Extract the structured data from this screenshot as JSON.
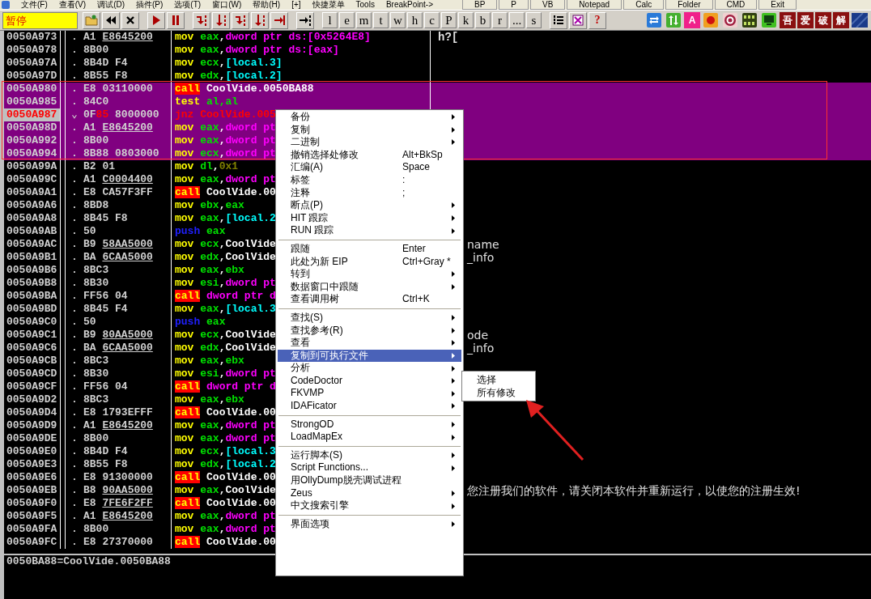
{
  "menubar": {
    "items": [
      "文件(F)",
      "查看(V)",
      "调试(D)",
      "插件(P)",
      "选项(T)",
      "窗口(W)",
      "帮助(H)",
      "[+]",
      "快捷菜单",
      "Tools",
      "BreakPoint->"
    ],
    "buttons": [
      "BP",
      "P",
      "VB",
      "Notepad",
      "Calc",
      "Folder",
      "CMD",
      "Exit"
    ]
  },
  "toolbar": {
    "status": "暂停",
    "letters": [
      "l",
      "e",
      "m",
      "t",
      "w",
      "h",
      "c",
      "P",
      "k",
      "b",
      "r",
      "...",
      "s"
    ],
    "help": "?",
    "plugin_texts": [
      "A",
      "吾",
      "爱",
      "破",
      "解"
    ]
  },
  "disassembly": {
    "rows": [
      {
        "address": "0050A973",
        "marker": ".",
        "selected": false,
        "current": false,
        "hex": [
          {
            "text": "A1",
            "kind": "plain"
          },
          {
            "text": "E8645200",
            "kind": "reloc"
          }
        ],
        "code": [
          {
            "text": "mov",
            "kind": "op"
          },
          {
            "text": "eax",
            "kind": "reg"
          },
          {
            "text": ",",
            "kind": "punct"
          },
          {
            "text": "dword ptr ds:[0x5264E8]",
            "kind": "mem"
          }
        ],
        "comment": "h?["
      },
      {
        "address": "0050A978",
        "marker": ".",
        "selected": false,
        "current": false,
        "hex": [
          {
            "text": "8B00",
            "kind": "plain"
          }
        ],
        "code": [
          {
            "text": "mov",
            "kind": "op"
          },
          {
            "text": "eax",
            "kind": "reg"
          },
          {
            "text": ",",
            "kind": "punct"
          },
          {
            "text": "dword ptr ds:[eax]",
            "kind": "mem"
          }
        ]
      },
      {
        "address": "0050A97A",
        "marker": ".",
        "selected": false,
        "current": false,
        "hex": [
          {
            "text": "8B4D",
            "kind": "plain"
          },
          {
            "text": "F4",
            "kind": "plain"
          }
        ],
        "code": [
          {
            "text": "mov",
            "kind": "op"
          },
          {
            "text": "ecx",
            "kind": "reg"
          },
          {
            "text": ",",
            "kind": "punct"
          },
          {
            "text": "[local.3]",
            "kind": "local"
          }
        ]
      },
      {
        "address": "0050A97D",
        "marker": ".",
        "selected": false,
        "current": false,
        "hex": [
          {
            "text": "8B55",
            "kind": "plain"
          },
          {
            "text": "F8",
            "kind": "plain"
          }
        ],
        "code": [
          {
            "text": "mov",
            "kind": "op"
          },
          {
            "text": "edx",
            "kind": "reg"
          },
          {
            "text": ",",
            "kind": "punct"
          },
          {
            "text": "[local.2]",
            "kind": "local"
          }
        ]
      },
      {
        "address": "0050A980",
        "marker": ".",
        "selected": true,
        "current": false,
        "hex": [
          {
            "text": "E8",
            "kind": "plain"
          },
          {
            "text": "03110000",
            "kind": "plain"
          }
        ],
        "code": [
          {
            "text": "call",
            "kind": "call"
          },
          {
            "text": "CoolVide.0050BA88",
            "kind": "sym"
          }
        ]
      },
      {
        "address": "0050A985",
        "marker": ".",
        "selected": true,
        "current": false,
        "hex": [
          {
            "text": "84C0",
            "kind": "plain"
          }
        ],
        "code": [
          {
            "text": "test",
            "kind": "op"
          },
          {
            "text": "al,al",
            "kind": "reg"
          }
        ]
      },
      {
        "address": "0050A987",
        "marker": "⌄",
        "selected": true,
        "current": true,
        "hex": [
          {
            "text": "0F",
            "kind": "plain"
          },
          {
            "text": "85",
            "kind": "changed"
          },
          {
            "text": "8000000",
            "kind": "plain"
          }
        ],
        "code": [
          {
            "text": "jnz",
            "kind": "jump"
          },
          {
            "text": "CoolVide.005",
            "kind": "jump"
          }
        ]
      },
      {
        "address": "0050A98D",
        "marker": ".",
        "selected": true,
        "current": false,
        "hex": [
          {
            "text": "A1",
            "kind": "plain"
          },
          {
            "text": "E8645200",
            "kind": "reloc"
          }
        ],
        "code": [
          {
            "text": "mov",
            "kind": "op"
          },
          {
            "text": "eax",
            "kind": "reg"
          },
          {
            "text": ",",
            "kind": "punct"
          },
          {
            "text": "dword pt",
            "kind": "mem"
          }
        ]
      },
      {
        "address": "0050A992",
        "marker": ".",
        "selected": true,
        "current": false,
        "hex": [
          {
            "text": "8B00",
            "kind": "plain"
          }
        ],
        "code": [
          {
            "text": "mov",
            "kind": "op"
          },
          {
            "text": "eax",
            "kind": "reg"
          },
          {
            "text": ",",
            "kind": "punct"
          },
          {
            "text": "dword pt",
            "kind": "mem"
          }
        ]
      },
      {
        "address": "0050A994",
        "marker": ".",
        "selected": true,
        "current": false,
        "hex": [
          {
            "text": "8B88",
            "kind": "plain"
          },
          {
            "text": "0803000",
            "kind": "plain"
          }
        ],
        "code": [
          {
            "text": "mov",
            "kind": "op"
          },
          {
            "text": "ecx",
            "kind": "reg"
          },
          {
            "text": ",",
            "kind": "punct"
          },
          {
            "text": "dword pt",
            "kind": "mem"
          }
        ]
      },
      {
        "address": "0050A99A",
        "marker": ".",
        "selected": false,
        "current": false,
        "hex": [
          {
            "text": "B2",
            "kind": "plain"
          },
          {
            "text": "01",
            "kind": "plain"
          }
        ],
        "code": [
          {
            "text": "mov",
            "kind": "op"
          },
          {
            "text": "dl",
            "kind": "reg"
          },
          {
            "text": ",",
            "kind": "punct"
          },
          {
            "text": "0x1",
            "kind": "imm"
          }
        ]
      },
      {
        "address": "0050A99C",
        "marker": ".",
        "selected": false,
        "current": false,
        "hex": [
          {
            "text": "A1",
            "kind": "plain"
          },
          {
            "text": "C0004400",
            "kind": "reloc"
          }
        ],
        "code": [
          {
            "text": "mov",
            "kind": "op"
          },
          {
            "text": "eax",
            "kind": "reg"
          },
          {
            "text": ",",
            "kind": "punct"
          },
          {
            "text": "dword pt",
            "kind": "mem"
          }
        ]
      },
      {
        "address": "0050A9A1",
        "marker": ".",
        "selected": false,
        "current": false,
        "hex": [
          {
            "text": "E8",
            "kind": "plain"
          },
          {
            "text": "CA57F3FF",
            "kind": "plain"
          }
        ],
        "code": [
          {
            "text": "call",
            "kind": "call"
          },
          {
            "text": "CoolVide.00",
            "kind": "sym"
          }
        ]
      },
      {
        "address": "0050A9A6",
        "marker": ".",
        "selected": false,
        "current": false,
        "hex": [
          {
            "text": "8BD8",
            "kind": "plain"
          }
        ],
        "code": [
          {
            "text": "mov",
            "kind": "op"
          },
          {
            "text": "ebx",
            "kind": "reg"
          },
          {
            "text": ",",
            "kind": "punct"
          },
          {
            "text": "eax",
            "kind": "reg"
          }
        ]
      },
      {
        "address": "0050A9A8",
        "marker": ".",
        "selected": false,
        "current": false,
        "hex": [
          {
            "text": "8B45",
            "kind": "plain"
          },
          {
            "text": "F8",
            "kind": "plain"
          }
        ],
        "code": [
          {
            "text": "mov",
            "kind": "op"
          },
          {
            "text": "eax",
            "kind": "reg"
          },
          {
            "text": ",",
            "kind": "punct"
          },
          {
            "text": "[local.2",
            "kind": "local"
          }
        ]
      },
      {
        "address": "0050A9AB",
        "marker": ".",
        "selected": false,
        "current": false,
        "hex": [
          {
            "text": "50",
            "kind": "plain"
          }
        ],
        "code": [
          {
            "text": "push",
            "kind": "push"
          },
          {
            "text": "eax",
            "kind": "reg"
          }
        ]
      },
      {
        "address": "0050A9AC",
        "marker": ".",
        "selected": false,
        "current": false,
        "hex": [
          {
            "text": "B9",
            "kind": "plain"
          },
          {
            "text": "58AA5000",
            "kind": "reloc"
          }
        ],
        "code": [
          {
            "text": "mov",
            "kind": "op"
          },
          {
            "text": "ecx",
            "kind": "reg"
          },
          {
            "text": ",",
            "kind": "punct"
          },
          {
            "text": "CoolVide",
            "kind": "sym"
          }
        ],
        "comment": "name",
        "comment_clipped": true
      },
      {
        "address": "0050A9B1",
        "marker": ".",
        "selected": false,
        "current": false,
        "hex": [
          {
            "text": "BA",
            "kind": "plain"
          },
          {
            "text": "6CAA5000",
            "kind": "reloc"
          }
        ],
        "code": [
          {
            "text": "mov",
            "kind": "op"
          },
          {
            "text": "edx",
            "kind": "reg"
          },
          {
            "text": ",",
            "kind": "punct"
          },
          {
            "text": "CoolVide",
            "kind": "sym"
          }
        ],
        "comment": "_info",
        "comment_clipped": true
      },
      {
        "address": "0050A9B6",
        "marker": ".",
        "selected": false,
        "current": false,
        "hex": [
          {
            "text": "8BC3",
            "kind": "plain"
          }
        ],
        "code": [
          {
            "text": "mov",
            "kind": "op"
          },
          {
            "text": "eax",
            "kind": "reg"
          },
          {
            "text": ",",
            "kind": "punct"
          },
          {
            "text": "ebx",
            "kind": "reg"
          }
        ]
      },
      {
        "address": "0050A9B8",
        "marker": ".",
        "selected": false,
        "current": false,
        "hex": [
          {
            "text": "8B30",
            "kind": "plain"
          }
        ],
        "code": [
          {
            "text": "mov",
            "kind": "op"
          },
          {
            "text": "esi",
            "kind": "reg"
          },
          {
            "text": ",",
            "kind": "punct"
          },
          {
            "text": "dword pt",
            "kind": "mem"
          }
        ]
      },
      {
        "address": "0050A9BA",
        "marker": ".",
        "selected": false,
        "current": false,
        "hex": [
          {
            "text": "FF56",
            "kind": "plain"
          },
          {
            "text": "04",
            "kind": "plain"
          }
        ],
        "code": [
          {
            "text": "call",
            "kind": "call"
          },
          {
            "text": "dword ptr d",
            "kind": "mem"
          }
        ]
      },
      {
        "address": "0050A9BD",
        "marker": ".",
        "selected": false,
        "current": false,
        "hex": [
          {
            "text": "8B45",
            "kind": "plain"
          },
          {
            "text": "F4",
            "kind": "plain"
          }
        ],
        "code": [
          {
            "text": "mov",
            "kind": "op"
          },
          {
            "text": "eax",
            "kind": "reg"
          },
          {
            "text": ",",
            "kind": "punct"
          },
          {
            "text": "[local.3",
            "kind": "local"
          }
        ]
      },
      {
        "address": "0050A9C0",
        "marker": ".",
        "selected": false,
        "current": false,
        "hex": [
          {
            "text": "50",
            "kind": "plain"
          }
        ],
        "code": [
          {
            "text": "push",
            "kind": "push"
          },
          {
            "text": "eax",
            "kind": "reg"
          }
        ]
      },
      {
        "address": "0050A9C1",
        "marker": ".",
        "selected": false,
        "current": false,
        "hex": [
          {
            "text": "B9",
            "kind": "plain"
          },
          {
            "text": "80AA5000",
            "kind": "reloc"
          }
        ],
        "code": [
          {
            "text": "mov",
            "kind": "op"
          },
          {
            "text": "ecx",
            "kind": "reg"
          },
          {
            "text": ",",
            "kind": "punct"
          },
          {
            "text": "CoolVide",
            "kind": "sym"
          }
        ],
        "comment": "ode",
        "comment_clipped": true
      },
      {
        "address": "0050A9C6",
        "marker": ".",
        "selected": false,
        "current": false,
        "hex": [
          {
            "text": "BA",
            "kind": "plain"
          },
          {
            "text": "6CAA5000",
            "kind": "reloc"
          }
        ],
        "code": [
          {
            "text": "mov",
            "kind": "op"
          },
          {
            "text": "edx",
            "kind": "reg"
          },
          {
            "text": ",",
            "kind": "punct"
          },
          {
            "text": "CoolVide",
            "kind": "sym"
          }
        ],
        "comment": "_info",
        "comment_clipped": true
      },
      {
        "address": "0050A9CB",
        "marker": ".",
        "selected": false,
        "current": false,
        "hex": [
          {
            "text": "8BC3",
            "kind": "plain"
          }
        ],
        "code": [
          {
            "text": "mov",
            "kind": "op"
          },
          {
            "text": "eax",
            "kind": "reg"
          },
          {
            "text": ",",
            "kind": "punct"
          },
          {
            "text": "ebx",
            "kind": "reg"
          }
        ]
      },
      {
        "address": "0050A9CD",
        "marker": ".",
        "selected": false,
        "current": false,
        "hex": [
          {
            "text": "8B30",
            "kind": "plain"
          }
        ],
        "code": [
          {
            "text": "mov",
            "kind": "op"
          },
          {
            "text": "esi",
            "kind": "reg"
          },
          {
            "text": ",",
            "kind": "punct"
          },
          {
            "text": "dword pt",
            "kind": "mem"
          }
        ]
      },
      {
        "address": "0050A9CF",
        "marker": ".",
        "selected": false,
        "current": false,
        "hex": [
          {
            "text": "FF56",
            "kind": "plain"
          },
          {
            "text": "04",
            "kind": "plain"
          }
        ],
        "code": [
          {
            "text": "call",
            "kind": "call"
          },
          {
            "text": "dword ptr d",
            "kind": "mem"
          }
        ]
      },
      {
        "address": "0050A9D2",
        "marker": ".",
        "selected": false,
        "current": false,
        "hex": [
          {
            "text": "8BC3",
            "kind": "plain"
          }
        ],
        "code": [
          {
            "text": "mov",
            "kind": "op"
          },
          {
            "text": "eax",
            "kind": "reg"
          },
          {
            "text": ",",
            "kind": "punct"
          },
          {
            "text": "ebx",
            "kind": "reg"
          }
        ]
      },
      {
        "address": "0050A9D4",
        "marker": ".",
        "selected": false,
        "current": false,
        "hex": [
          {
            "text": "E8",
            "kind": "plain"
          },
          {
            "text": "1793EFFF",
            "kind": "plain"
          }
        ],
        "code": [
          {
            "text": "call",
            "kind": "call"
          },
          {
            "text": "CoolVide.00",
            "kind": "sym"
          }
        ]
      },
      {
        "address": "0050A9D9",
        "marker": ".",
        "selected": false,
        "current": false,
        "hex": [
          {
            "text": "A1",
            "kind": "plain"
          },
          {
            "text": "E8645200",
            "kind": "reloc"
          }
        ],
        "code": [
          {
            "text": "mov",
            "kind": "op"
          },
          {
            "text": "eax",
            "kind": "reg"
          },
          {
            "text": ",",
            "kind": "punct"
          },
          {
            "text": "dword pt",
            "kind": "mem"
          }
        ]
      },
      {
        "address": "0050A9DE",
        "marker": ".",
        "selected": false,
        "current": false,
        "hex": [
          {
            "text": "8B00",
            "kind": "plain"
          }
        ],
        "code": [
          {
            "text": "mov",
            "kind": "op"
          },
          {
            "text": "eax",
            "kind": "reg"
          },
          {
            "text": ",",
            "kind": "punct"
          },
          {
            "text": "dword pt",
            "kind": "mem"
          }
        ]
      },
      {
        "address": "0050A9E0",
        "marker": ".",
        "selected": false,
        "current": false,
        "hex": [
          {
            "text": "8B4D",
            "kind": "plain"
          },
          {
            "text": "F4",
            "kind": "plain"
          }
        ],
        "code": [
          {
            "text": "mov",
            "kind": "op"
          },
          {
            "text": "ecx",
            "kind": "reg"
          },
          {
            "text": ",",
            "kind": "punct"
          },
          {
            "text": "[local.3",
            "kind": "local"
          }
        ]
      },
      {
        "address": "0050A9E3",
        "marker": ".",
        "selected": false,
        "current": false,
        "hex": [
          {
            "text": "8B55",
            "kind": "plain"
          },
          {
            "text": "F8",
            "kind": "plain"
          }
        ],
        "code": [
          {
            "text": "mov",
            "kind": "op"
          },
          {
            "text": "edx",
            "kind": "reg"
          },
          {
            "text": ",",
            "kind": "punct"
          },
          {
            "text": "[local.2",
            "kind": "local"
          }
        ]
      },
      {
        "address": "0050A9E6",
        "marker": ".",
        "selected": false,
        "current": false,
        "hex": [
          {
            "text": "E8",
            "kind": "plain"
          },
          {
            "text": "91300000",
            "kind": "plain"
          }
        ],
        "code": [
          {
            "text": "call",
            "kind": "call"
          },
          {
            "text": "CoolVide.00",
            "kind": "sym"
          }
        ]
      },
      {
        "address": "0050A9EB",
        "marker": ".",
        "selected": false,
        "current": false,
        "hex": [
          {
            "text": "B8",
            "kind": "plain"
          },
          {
            "text": "90AA5000",
            "kind": "reloc"
          }
        ],
        "code": [
          {
            "text": "mov",
            "kind": "op"
          },
          {
            "text": "eax",
            "kind": "reg"
          },
          {
            "text": ",",
            "kind": "punct"
          },
          {
            "text": "CoolVide",
            "kind": "sym"
          }
        ],
        "comment": "您注册我们的软件，请关闭本软件并重新运行，以使您的注册生效!",
        "comment_clipped": true
      },
      {
        "address": "0050A9F0",
        "marker": ".",
        "selected": false,
        "current": false,
        "hex": [
          {
            "text": "E8",
            "kind": "plain"
          },
          {
            "text": "7FE6F2FF",
            "kind": "reloc"
          }
        ],
        "code": [
          {
            "text": "call",
            "kind": "call"
          },
          {
            "text": "CoolVide.00",
            "kind": "sym"
          }
        ]
      },
      {
        "address": "0050A9F5",
        "marker": ".",
        "selected": false,
        "current": false,
        "hex": [
          {
            "text": "A1",
            "kind": "plain"
          },
          {
            "text": "E8645200",
            "kind": "reloc"
          }
        ],
        "code": [
          {
            "text": "mov",
            "kind": "op"
          },
          {
            "text": "eax",
            "kind": "reg"
          },
          {
            "text": ",",
            "kind": "punct"
          },
          {
            "text": "dword pt",
            "kind": "mem"
          }
        ]
      },
      {
        "address": "0050A9FA",
        "marker": ".",
        "selected": false,
        "current": false,
        "hex": [
          {
            "text": "8B00",
            "kind": "plain"
          }
        ],
        "code": [
          {
            "text": "mov",
            "kind": "op"
          },
          {
            "text": "eax",
            "kind": "reg"
          },
          {
            "text": ",",
            "kind": "punct"
          },
          {
            "text": "dword pt",
            "kind": "mem"
          }
        ]
      },
      {
        "address": "0050A9FC",
        "marker": ".",
        "selected": false,
        "current": false,
        "hex": [
          {
            "text": "E8",
            "kind": "plain"
          },
          {
            "text": "27370000",
            "kind": "plain"
          }
        ],
        "code": [
          {
            "text": "call",
            "kind": "call"
          },
          {
            "text": "CoolVide.00",
            "kind": "sym"
          }
        ]
      }
    ]
  },
  "context_menu": {
    "items": [
      {
        "kind": "item",
        "label": "备份",
        "submenu": true,
        "selected": false
      },
      {
        "kind": "item",
        "label": "复制",
        "submenu": true,
        "selected": false
      },
      {
        "kind": "item",
        "label": "二进制",
        "submenu": true,
        "selected": false
      },
      {
        "kind": "item",
        "label": "撤销选择处修改",
        "shortcut": "Alt+BkSp",
        "submenu": false,
        "selected": false
      },
      {
        "kind": "item",
        "label": "汇编(A)",
        "shortcut": "Space",
        "submenu": false,
        "selected": false
      },
      {
        "kind": "item",
        "label": "标签",
        "shortcut": ":",
        "submenu": false,
        "selected": false
      },
      {
        "kind": "item",
        "label": "注释",
        "shortcut": ";",
        "submenu": false,
        "selected": false
      },
      {
        "kind": "item",
        "label": "断点(P)",
        "submenu": true,
        "selected": false
      },
      {
        "kind": "item",
        "label": "HIT 跟踪",
        "submenu": true,
        "selected": false
      },
      {
        "kind": "item",
        "label": "RUN 跟踪",
        "submenu": true,
        "selected": false
      },
      {
        "kind": "separator"
      },
      {
        "kind": "item",
        "label": "跟随",
        "shortcut": "Enter",
        "submenu": false,
        "selected": false
      },
      {
        "kind": "item",
        "label": "此处为新 EIP",
        "shortcut": "Ctrl+Gray *",
        "submenu": false,
        "selected": false
      },
      {
        "kind": "item",
        "label": "转到",
        "submenu": true,
        "selected": false
      },
      {
        "kind": "item",
        "label": "数据窗口中跟随",
        "submenu": true,
        "selected": false
      },
      {
        "kind": "item",
        "label": "查看调用树",
        "shortcut": "Ctrl+K",
        "submenu": false,
        "selected": false
      },
      {
        "kind": "separator"
      },
      {
        "kind": "item",
        "label": "查找(S)",
        "submenu": true,
        "selected": false
      },
      {
        "kind": "item",
        "label": "查找参考(R)",
        "submenu": true,
        "selected": false
      },
      {
        "kind": "item",
        "label": "查看",
        "submenu": true,
        "selected": false
      },
      {
        "kind": "item",
        "label": "复制到可执行文件",
        "submenu": true,
        "selected": true
      },
      {
        "kind": "item",
        "label": "分析",
        "submenu": true,
        "selected": false
      },
      {
        "kind": "item",
        "label": "CodeDoctor",
        "submenu": true,
        "selected": false
      },
      {
        "kind": "item",
        "label": "FKVMP",
        "submenu": true,
        "selected": false
      },
      {
        "kind": "item",
        "label": "IDAFicator",
        "submenu": true,
        "selected": false
      },
      {
        "kind": "separator"
      },
      {
        "kind": "item",
        "label": "StrongOD",
        "submenu": true,
        "selected": false
      },
      {
        "kind": "item",
        "label": "LoadMapEx",
        "submenu": true,
        "selected": false
      },
      {
        "kind": "separator"
      },
      {
        "kind": "item",
        "label": "运行脚本(S)",
        "submenu": true,
        "selected": false
      },
      {
        "kind": "item",
        "label": "Script Functions...",
        "submenu": true,
        "selected": false
      },
      {
        "kind": "item",
        "label": "用OllyDump脱壳调试进程",
        "submenu": false,
        "selected": false
      },
      {
        "kind": "item",
        "label": "Zeus",
        "submenu": true,
        "selected": false
      },
      {
        "kind": "item",
        "label": "中文搜索引擎",
        "submenu": true,
        "selected": false
      },
      {
        "kind": "separator"
      },
      {
        "kind": "item",
        "label": "界面选项",
        "submenu": true,
        "selected": false
      }
    ]
  },
  "submenu": {
    "items": [
      {
        "label": "选择",
        "selected": false
      },
      {
        "label": "所有修改",
        "selected": false
      }
    ]
  },
  "info_pane": {
    "text": "0050BA88=CoolVide.0050BA88"
  }
}
